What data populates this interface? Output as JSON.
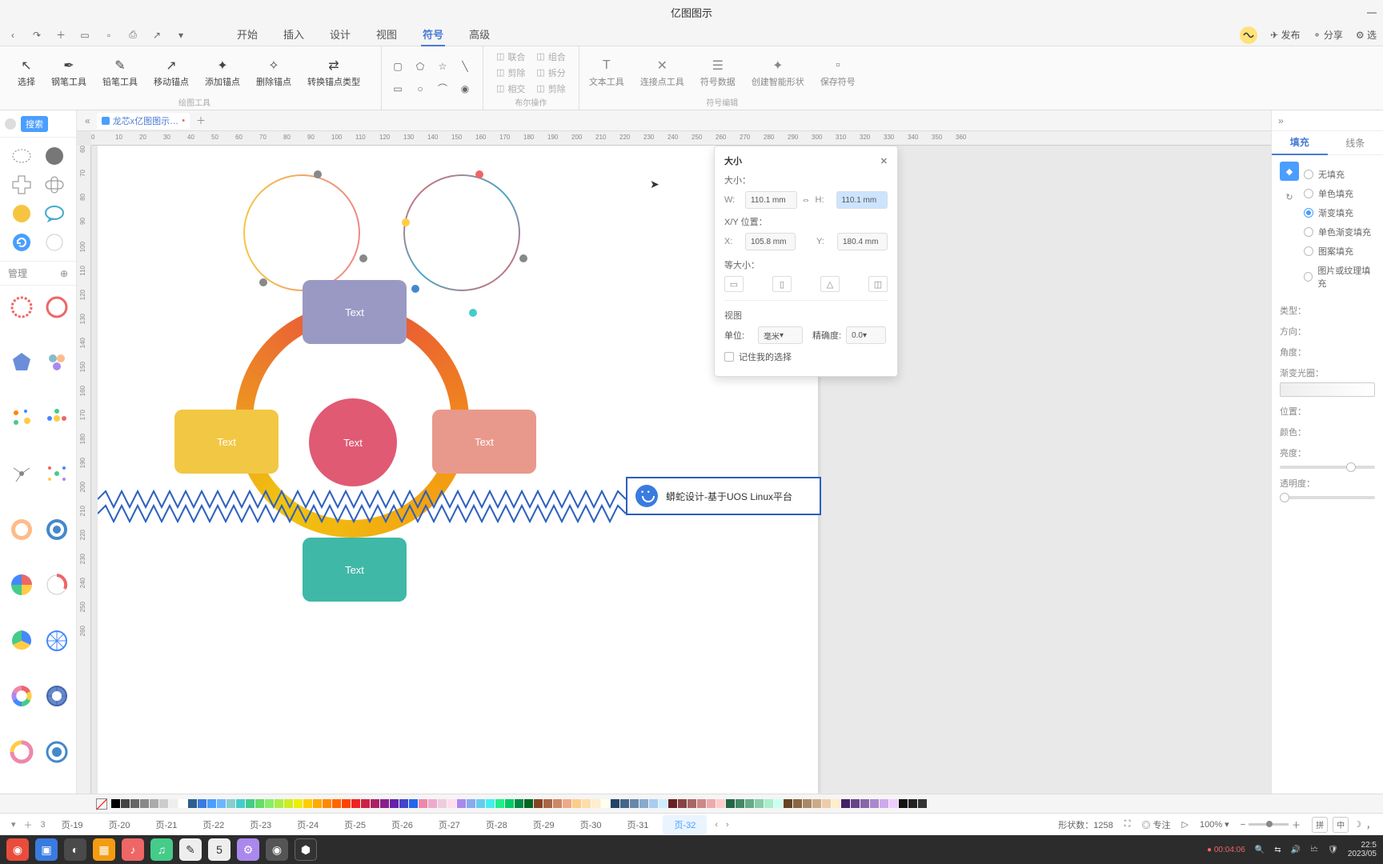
{
  "app_title": "亿图图示",
  "menu": {
    "tabs": [
      "开始",
      "插入",
      "设计",
      "视图",
      "符号",
      "高级"
    ],
    "active": 4,
    "right": {
      "publish": "发布",
      "share": "分享",
      "select": "选"
    }
  },
  "ribbon": {
    "tools": [
      {
        "label": "选择"
      },
      {
        "label": "钢笔工具"
      },
      {
        "label": "铅笔工具"
      },
      {
        "label": "移动锚点"
      },
      {
        "label": "添加锚点"
      },
      {
        "label": "删除锚点"
      },
      {
        "label": "转换锚点类型"
      }
    ],
    "group_drawing": "绘图工具",
    "boolean": {
      "items": [
        "联合",
        "组合",
        "剪除",
        "拆分",
        "相交",
        "剪除"
      ],
      "label": "布尔操作"
    },
    "symbol_tools": [
      {
        "label": "文本工具"
      },
      {
        "label": "连接点工具"
      },
      {
        "label": "符号数据"
      },
      {
        "label": "创建智能形状"
      },
      {
        "label": "保存符号"
      }
    ],
    "group_symbol": "符号编辑"
  },
  "doc_tab": "龙芯x亿图图示…",
  "shape_lib": {
    "search": "搜索",
    "manage": "管理"
  },
  "canvas": {
    "texts": [
      "Text",
      "Text",
      "Text",
      "Text",
      "Text"
    ],
    "callout": "蟒蛇设计-基于UOS Linux平台"
  },
  "size_panel": {
    "title": "大小",
    "size_label": "大小：",
    "w": "W:",
    "w_val": "110.1 mm",
    "h": "H:",
    "h_val": "110.1 mm",
    "pos_label": "X/Y 位置：",
    "x": "X:",
    "x_val": "105.8 mm",
    "y": "Y:",
    "y_val": "180.4 mm",
    "equal": "等大小：",
    "view": "视图",
    "unit": "单位:",
    "unit_val": "毫米",
    "precision": "精确度:",
    "precision_val": "0.0",
    "remember": "记住我的选择"
  },
  "props": {
    "tabs": [
      "填充",
      "线条"
    ],
    "fill_modes": [
      "无填充",
      "单色填充",
      "渐变填充",
      "单色渐变填充",
      "图案填充",
      "图片或纹理填充"
    ],
    "fill_active": 2,
    "type": "类型：",
    "direction": "方向：",
    "angle": "角度：",
    "grad_ring": "渐变光圈：",
    "position": "位置：",
    "color": "颜色：",
    "brightness": "亮度：",
    "opacity": "透明度："
  },
  "page_tabs": {
    "pages": [
      "页-19",
      "页-20",
      "页-21",
      "页-22",
      "页-23",
      "页-24",
      "页-25",
      "页-26",
      "页-27",
      "页-28",
      "页-29",
      "页-30",
      "页-31",
      "页-32"
    ],
    "active": 13,
    "shape_count_label": "形状数：",
    "shape_count": "1258",
    "focus": "专注",
    "zoom": "100%"
  },
  "ime": {
    "pin": "拼",
    "zhong": "中"
  },
  "taskbar": {
    "time": "22:5",
    "date": "2023/05",
    "rec": "00:04:06"
  },
  "ruler_h": [
    0,
    10,
    20,
    30,
    40,
    50,
    60,
    70,
    80,
    90,
    100,
    110,
    120,
    130,
    140,
    150,
    160,
    170,
    180,
    190,
    200,
    210,
    220,
    230,
    240,
    250,
    260,
    270,
    280,
    290,
    300,
    310,
    320,
    330,
    340,
    350,
    360
  ],
  "ruler_v": [
    60,
    70,
    80,
    90,
    100,
    110,
    120,
    130,
    140,
    150,
    160,
    170,
    180,
    190,
    200,
    210,
    220,
    230,
    240,
    250,
    260
  ]
}
